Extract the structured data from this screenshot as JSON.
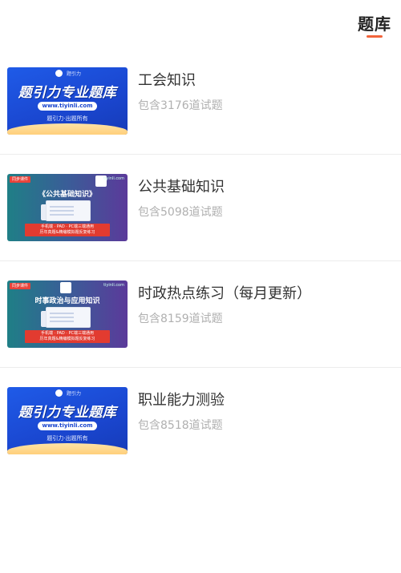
{
  "header": {
    "tab_title": "题库"
  },
  "items": [
    {
      "title": "工会知识",
      "count": "包含3176道试题",
      "banner": {
        "style": "blue",
        "logo_text": "题引力",
        "headline": "题引力专业题库",
        "url": "www.tiyinli.com",
        "sub": "题引力·出题所有"
      }
    },
    {
      "title": "公共基础知识",
      "count": "包含5098道试题",
      "banner": {
        "style": "grad",
        "tag": "同步课件",
        "site": "tiyinli.com",
        "heading": "《公共基础知识》",
        "red_line1": "手机端 · PAD · PC端三端通用",
        "red_line2": "历年真题&精编模拟题反复练习"
      }
    },
    {
      "title": "时政热点练习（每月更新）",
      "count": "包含8159道试题",
      "banner": {
        "style": "grad",
        "tag": "同步课件",
        "site": "tiyinli.com",
        "heading": "时事政治与应用知识",
        "red_line1": "手机端 · PAD · PC端三端通用",
        "red_line2": "历年真题&精编模拟题反复练习"
      }
    },
    {
      "title": "职业能力测验",
      "count": "包含8518道试题",
      "banner": {
        "style": "blue",
        "logo_text": "题引力",
        "headline": "题引力专业题库",
        "url": "www.tiyinli.com",
        "sub": "题引力·出题所有"
      }
    }
  ],
  "colors": {
    "accent": "#f2643b",
    "title_text": "#333333",
    "count_text": "#b0b0b0",
    "divider": "#ececec"
  }
}
